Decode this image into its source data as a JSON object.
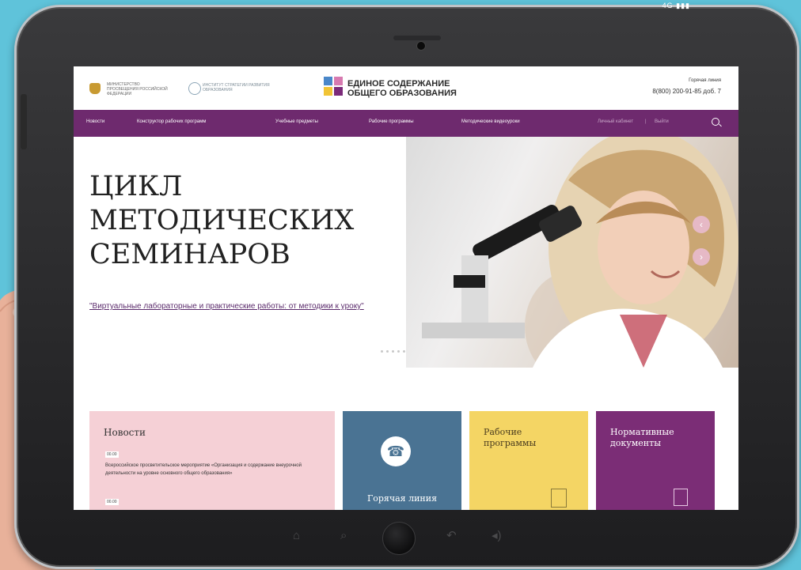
{
  "device": {
    "corner_label": "4G  ▮▮▮"
  },
  "header": {
    "ministry_text": "МИНИСТЕРСТВО ПРОСВЕЩЕНИЯ РОССИЙСКОЙ ФЕДЕРАЦИИ",
    "institute_text": "ИНСТИТУТ СТРАТЕГИИ РАЗВИТИЯ ОБРАЗОВАНИЯ",
    "brand_line1": "ЕДИНОЕ СОДЕРЖАНИЕ",
    "brand_line2": "ОБЩЕГО ОБРАЗОВАНИЯ",
    "hotline_label": "Горячая линия",
    "hotline_phone": "8(800) 200-91-85 доб. 7"
  },
  "nav": {
    "items": [
      {
        "label": "Новости"
      },
      {
        "label": "Конструктор рабочих программ"
      },
      {
        "label": "Учебные предметы"
      },
      {
        "label": "Рабочие программы"
      },
      {
        "label": "Методические видеоуроки"
      }
    ],
    "account": "Личный кабинет",
    "separator": "|",
    "logout": "Выйти"
  },
  "hero": {
    "title_line1": "ЦИКЛ",
    "title_line2": "МЕТОДИЧЕСКИХ",
    "title_line3": "СЕМИНАРОВ",
    "link_text": "\"Виртуальные лабораторные и практические работы: от методики к уроку\"",
    "prev_arrow": "‹",
    "next_arrow": "›"
  },
  "tiles": {
    "news": {
      "title": "Новости",
      "items": [
        {
          "date": "00.00",
          "text": "Всероссийское просветительское мероприятие «Организация и содержание внеурочной деятельности на уровне основного общего образования»"
        },
        {
          "date": "00.00",
          "text": ""
        }
      ]
    },
    "hotline": {
      "title": "Горячая линия"
    },
    "programs": {
      "title_line1": "Рабочие",
      "title_line2": "программы"
    },
    "documents": {
      "title_line1": "Нормативные",
      "title_line2": "документы"
    }
  },
  "colors": {
    "nav_bg": "#6e2a6e",
    "news_bg": "#f5d0d6",
    "hotline_bg": "#4a7393",
    "programs_bg": "#f4d564",
    "documents_bg": "#7b2d76",
    "frame_bg": "#5fc3da"
  },
  "icons": {
    "emblem": "eagle-emblem-icon",
    "search": "search-icon",
    "phone": "phone-icon",
    "document": "document-icon",
    "documents": "documents-icon",
    "home": "home-icon",
    "back": "back-icon",
    "volume": "volume-icon"
  }
}
